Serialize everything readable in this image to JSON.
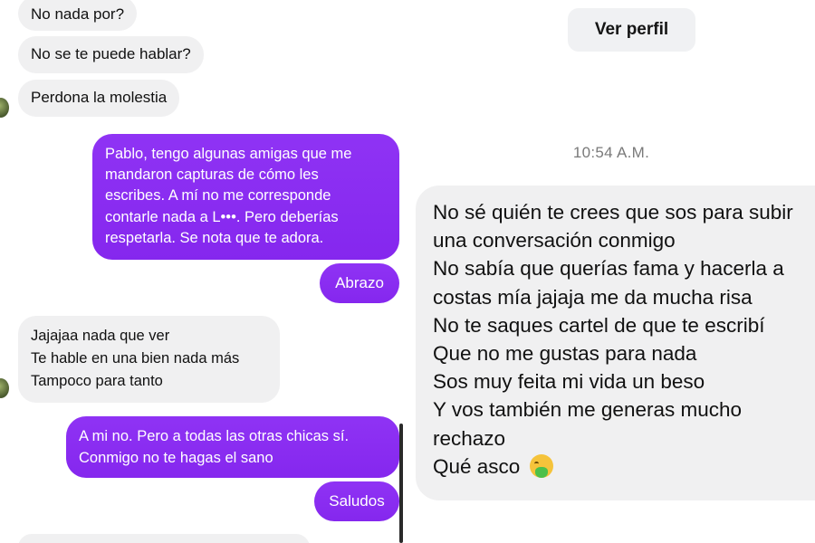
{
  "left_chat": {
    "incoming_group_1": [
      "No nada por?",
      "No se te puede hablar?",
      "Perdona la molestia"
    ],
    "outgoing_1": {
      "lines": [
        "Pablo, tengo algunas amigas que me",
        "mandaron capturas de cómo les",
        "escribes. A mí no me corresponde",
        "contarle nada a L•••. Pero deberías",
        "respetarla. Se nota que te adora."
      ]
    },
    "outgoing_2": "Abrazo",
    "incoming_2": {
      "lines": [
        "Jajajaa nada que ver",
        "Te hable en una bien nada más",
        "Tampoco para tanto"
      ]
    },
    "outgoing_3": {
      "lines": [
        "A mi no. Pero a todas las otras chicas sí.",
        "Conmigo no te hagas el sano"
      ]
    },
    "outgoing_4": "Saludos"
  },
  "right_chat": {
    "view_profile_label": "Ver perfil",
    "timestamp": "10:54 A.M.",
    "message_lines": [
      "No sé quién te crees que sos para subir",
      "una conversación conmigo",
      "No sabía que querías fama y hacerla a",
      "costas mía jajaja me da mucha risa",
      "No te saques cartel de que te escribí",
      "Que no me gustas para nada",
      "Sos muy feita mi vida un beso",
      "Y vos también me generas mucho",
      "rechazo",
      "Qué asco"
    ],
    "emoji_name": "face-vomiting-icon"
  },
  "colors": {
    "outgoing_bubble": "#8b2cf2",
    "incoming_bubble": "#f0f0f1",
    "timestamp_text": "#7a7a7a"
  }
}
